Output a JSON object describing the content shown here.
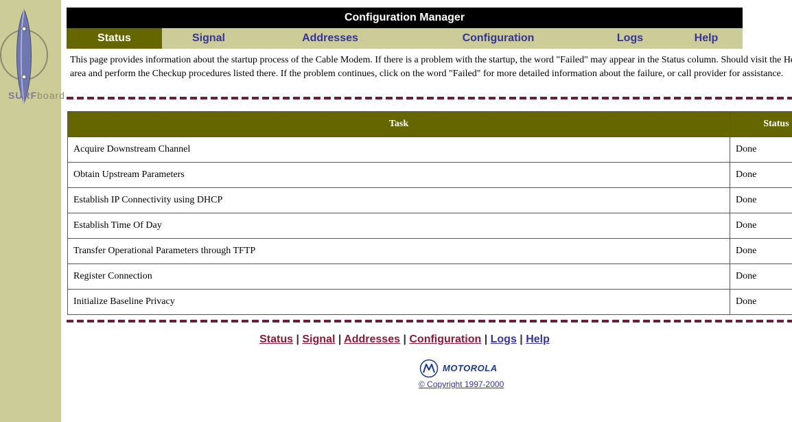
{
  "brand": {
    "logo_text_prefix": "SURF",
    "logo_text_suffix": "board"
  },
  "header": {
    "title": "Configuration Manager"
  },
  "nav": {
    "items": [
      {
        "label": "Status"
      },
      {
        "label": "Signal"
      },
      {
        "label": "Addresses"
      },
      {
        "label": "Configuration"
      },
      {
        "label": "Logs"
      },
      {
        "label": "Help"
      }
    ],
    "active": "Status"
  },
  "intro": {
    "text": "This page provides information about the startup process of the Cable Modem. If there is a problem with the startup, the word \"Failed\" may appear in the Status column. Should visit the Help area and perform the Checkup procedures listed there. If the problem continues, click on the word \"Failed\" for more detailed information about the failure, or call provider for assistance."
  },
  "table": {
    "headers": [
      "Task",
      "Status"
    ],
    "rows": [
      {
        "task": "Acquire Downstream Channel",
        "status": "Done"
      },
      {
        "task": "Obtain Upstream Parameters",
        "status": "Done"
      },
      {
        "task": "Establish IP Connectivity using DHCP",
        "status": "Done"
      },
      {
        "task": "Establish Time Of Day",
        "status": "Done"
      },
      {
        "task": "Transfer Operational Parameters through TFTP",
        "status": "Done"
      },
      {
        "task": "Register Connection",
        "status": "Done"
      },
      {
        "task": "Initialize Baseline Privacy",
        "status": "Done"
      }
    ]
  },
  "footer": {
    "links": [
      {
        "label": "Status"
      },
      {
        "label": "Signal"
      },
      {
        "label": "Addresses"
      },
      {
        "label": "Configuration"
      },
      {
        "label": "Logs"
      },
      {
        "label": "Help"
      }
    ],
    "separator": " | ",
    "company": "MOTOROLA",
    "copyright": "© Copyright 1997-2000"
  },
  "colors": {
    "sidebar": "#cccc99",
    "header_bg": "#000000",
    "nav_active_bg": "#666600",
    "table_header_bg": "#666600",
    "divider": "#6b1f36",
    "link_maroon": "#8b1a3a",
    "link_blue": "#333399"
  }
}
